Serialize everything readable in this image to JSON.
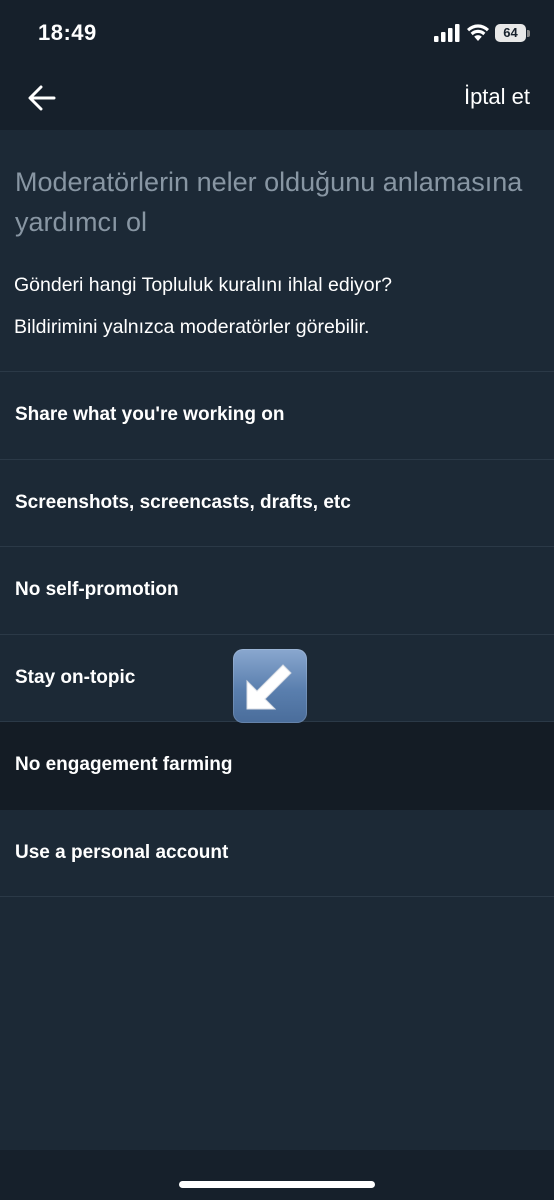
{
  "status_bar": {
    "time": "18:49",
    "battery": "64"
  },
  "nav": {
    "back_icon": "arrow-left-icon",
    "cancel_label": "İptal et"
  },
  "main": {
    "headline": "Moderatörlerin neler olduğunu anlamasına yardımcı ol",
    "question": "Gönderi hangi Topluluk kuralını ihlal ediyor?",
    "note": "Bildirimini yalnızca moderatörler görebilir."
  },
  "rules": [
    {
      "label": "Share what you're working on"
    },
    {
      "label": "Screenshots, screencasts, drafts, etc"
    },
    {
      "label": "No self-promotion"
    },
    {
      "label": "Stay on-topic"
    },
    {
      "label": "No engagement farming"
    },
    {
      "label": "Use a personal account"
    }
  ],
  "overlay": {
    "icon": "down-left-arrow-emoji-icon"
  },
  "colors": {
    "background": "#1c2936",
    "bar": "#16202b",
    "headline": "#8896a3",
    "divider": "#2b3947",
    "highlight_row": "#141c25"
  }
}
